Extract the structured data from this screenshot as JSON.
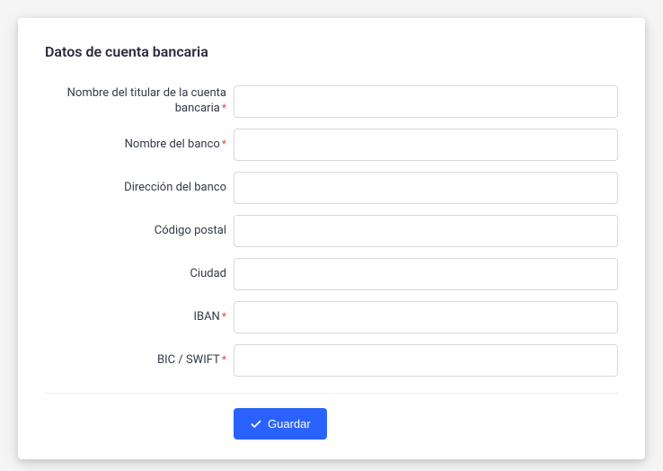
{
  "title": "Datos de cuenta bancaria",
  "fields": {
    "account_holder": {
      "label": "Nombre del titular de la cuenta bancaria",
      "required": true,
      "value": ""
    },
    "bank_name": {
      "label": "Nombre del banco",
      "required": true,
      "value": ""
    },
    "bank_address": {
      "label": "Dirección del banco",
      "required": false,
      "value": ""
    },
    "postal_code": {
      "label": "Código postal",
      "required": false,
      "value": ""
    },
    "city": {
      "label": "Ciudad",
      "required": false,
      "value": ""
    },
    "iban": {
      "label": "IBAN",
      "required": true,
      "value": ""
    },
    "bic_swift": {
      "label": "BIC / SWIFT",
      "required": true,
      "value": ""
    }
  },
  "required_marker": "*",
  "save_button_label": "Guardar"
}
